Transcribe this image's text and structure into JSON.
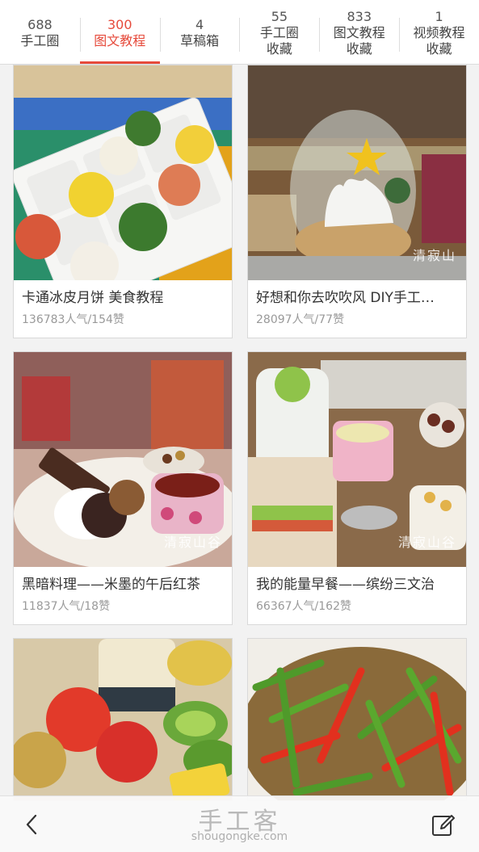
{
  "tabs": [
    {
      "count": "688",
      "name": "手工圈",
      "active": false
    },
    {
      "count": "300",
      "name": "图文教程",
      "active": true
    },
    {
      "count": "4",
      "name": "草稿箱",
      "active": false
    },
    {
      "count": "55",
      "name": "手工圈\n收藏",
      "active": false
    },
    {
      "count": "833",
      "name": "图文教程\n收藏",
      "active": false
    },
    {
      "count": "1",
      "name": "视频教程\n收藏",
      "active": false
    }
  ],
  "cards": [
    {
      "title": "卡通冰皮月饼 美食教程",
      "stats": "136783人气/154赞"
    },
    {
      "title": "好想和你去吹吹风 DIY手工…",
      "stats": "28097人气/77赞",
      "watermark": "清寂山"
    },
    {
      "title": "黑暗料理——米墨的午后红茶",
      "stats": "11837人气/18赞",
      "watermark": "清寂山谷"
    },
    {
      "title": "我的能量早餐——缤纷三文治",
      "stats": "66367人气/162赞",
      "watermark": "清寂山谷"
    },
    {
      "title": "",
      "stats": ""
    },
    {
      "title": "",
      "stats": ""
    }
  ],
  "bottom": {
    "watermark_big": "手工客",
    "watermark_small": "shougongke.com"
  }
}
